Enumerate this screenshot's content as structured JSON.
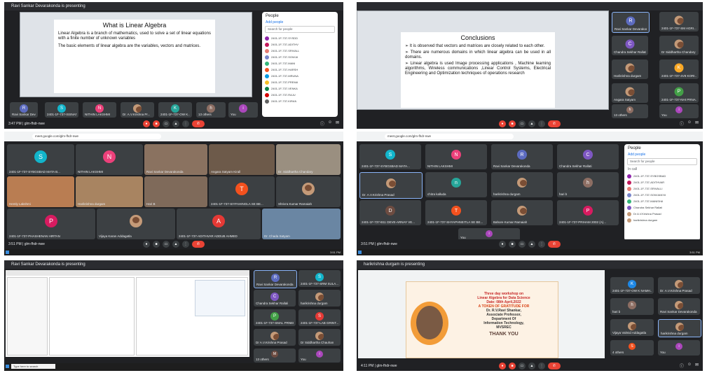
{
  "panels": {
    "p1": {
      "presenting": "Ravi Sankar Devarakonda is presenting",
      "slide_title": "What is Linear Algebra",
      "slide_paras": [
        "Linear Algebra is a branch of mathematics, used to solve a set of linear equations with a finite number of unknown variables",
        "The basic elements of linear algebra are the variables, vectors and matrices."
      ],
      "people_title": "People",
      "add_people": "Add people",
      "search_placeholder": "Search for people",
      "tiles": [
        "Ravi Sankar Deva...",
        "2401-1F-737-ISSNAN...",
        "NITHIN LAKSHMI",
        "Dr. A.V.Krishna Pr...",
        "2401-1F-737-OW K...",
        "13 others",
        "You"
      ],
      "meeting_info": "3:47 PM | glm-fhdr-nwe"
    },
    "p2": {
      "slide_title": "Conclusions",
      "bullets": [
        "It is observed that vectors and matrices are closely related to each other.",
        "There are numerous domains in which linear algebra can be used in all domains.",
        "Linear algebra is used Image processing applications , Machine learning algorithms, Wireless communications ,Linear Control Systems, Electrical Engineering and Optimization techniques of operations research"
      ],
      "tiles": [
        "Ravi Sankar Devarakonda",
        "2401-1F-737-SM AGRI...",
        "Chandra Sekhar Rallati",
        "Dr Siddhartha Chandary",
        "Harikrishna durgam",
        "2401-1F-737-4V8 KORI...",
        "Angara Satyam",
        "2401-1F-737-NHI PRNA...",
        "13 others",
        "You"
      ]
    },
    "p3": {
      "url": "meet.google.com/glm-fhdr-nwe",
      "tiles": [
        "2401-1F-737-SYBGSBAD MATA B...",
        "NITHIN LAKSHMI",
        "Ravi Sankar Devarakonda",
        "Angara Satyam Kirall",
        "Dr. Siddhartha Chandary",
        "Hemly Lakshmi",
        "Harikrishna durgam",
        "Hari B",
        "2401-1F-737-SIYFAHINGLA SE BE...",
        "Shrivra Kumar Ramaiah",
        "2401-1F-737-PHASHENAN HIRTAN",
        "Vijaya Karan Addagatla",
        "2401-1F-737-ADITHVAR ADDUB AHMED",
        "Dr. Chada Satyam"
      ],
      "meeting_info": "3:51 PM | glm-fhdr-nwe"
    },
    "p4": {
      "url": "meet.google.com/glm-fhdr-nwe",
      "people_title": "People",
      "add_people": "Add people",
      "search_placeholder": "Search for people",
      "in_call": "In call",
      "tiles": [
        "2401-1F-737-SYBGSBAD MATA...",
        "NITHIN LAKSHMI",
        "Ravi Sankar Devarakonda",
        "Chandra Sekhar Rallati",
        "Dr. A.V.Krishna Prasad",
        "chitra kalluda",
        "harikrishna durgam",
        "hari b",
        "2401-1F-737-B11 DEVE-ARNAY VE...",
        "2401-1F-737-SHYAPHNEITLA SE BE...",
        "Bahore Kumar Ramaiah",
        "2401-1F-737-PRIHAM 2002 (A)...",
        "You"
      ],
      "meeting_info": "3:51 PM | glm-fhdr-nwe"
    },
    "p5": {
      "presenting": "Ravi Sankar Devarakonda is presenting",
      "tiles": [
        "Ravi Sankar Devarakonda",
        "2401-1F-737-SRM SULA...",
        "Chandra Sekhar Rallali",
        "harikrishna durgam",
        "2401-1F-737-SMAL PRNEDL...",
        "2401-1F-737-LAB GRINT...",
        "Dr A.V.Krishna Prasad",
        "Dr Siddhartha Chauhan",
        "13 others",
        "You"
      ],
      "search_placeholder": "Type here to search"
    },
    "p6": {
      "presenting": "harikrishna durgam is presenting",
      "banner_line1": "Three day workshop on",
      "banner_line2": "Linear Algebra for Data Science",
      "banner_date": "Date: 08th April,2022",
      "banner_token": "A TOKEN OF GRATITUDE FOR",
      "banner_name": "Dr. R.V.Ravi Shankar,",
      "banner_role1": "Associate Professor,",
      "banner_role2": "Department Of",
      "banner_role3": "Information Technology,",
      "banner_role4": "MVSREC",
      "thank_you": "THANK YOU",
      "tiles": [
        "2401-1F-737-OW K NAMH...",
        "Dr. A.V.Krishna Prasad",
        "hari b",
        "Ravi Sankar Devarakonda",
        "Vijaya Valmid Addagatla",
        "harikrishna durgam",
        "4 others",
        "You"
      ],
      "meeting_info": "4:11 PM | glm-fhdr-nwe"
    }
  },
  "colors": {
    "meet_bg": "#202124",
    "tile_bg": "#3c4043",
    "end_call": "#ea4335",
    "accent": "#1a73e8"
  }
}
